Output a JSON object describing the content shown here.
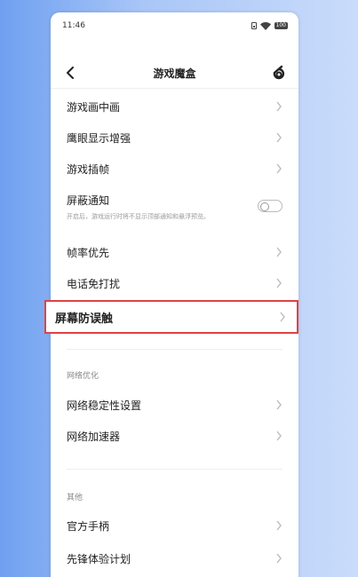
{
  "status": {
    "time": "11:46",
    "battery": "100"
  },
  "header": {
    "title": "游戏魔盒",
    "back_icon": "back-arrow-icon",
    "logo_icon": "brand-logo-icon"
  },
  "items": [
    {
      "label": "游戏画中画"
    },
    {
      "label": "鹰眼显示增强"
    },
    {
      "label": "游戏插帧"
    },
    {
      "label": "屏蔽通知",
      "description": "开启后，游戏运行时将不显示顶部通知和悬浮预览。",
      "toggle": "off"
    },
    {
      "label": "帧率优先"
    },
    {
      "label": "电话免打扰"
    },
    {
      "label": "屏幕防误触",
      "highlighted": true
    }
  ],
  "network": {
    "title": "网络优化",
    "items": [
      {
        "label": "网络稳定性设置"
      },
      {
        "label": "网络加速器"
      }
    ]
  },
  "other": {
    "title": "其他",
    "items": [
      {
        "label": "官方手柄"
      },
      {
        "label": "先锋体验计划"
      }
    ]
  },
  "colors": {
    "highlight_border": "#e04242",
    "background_gradient_left": "#6fa0f0"
  }
}
